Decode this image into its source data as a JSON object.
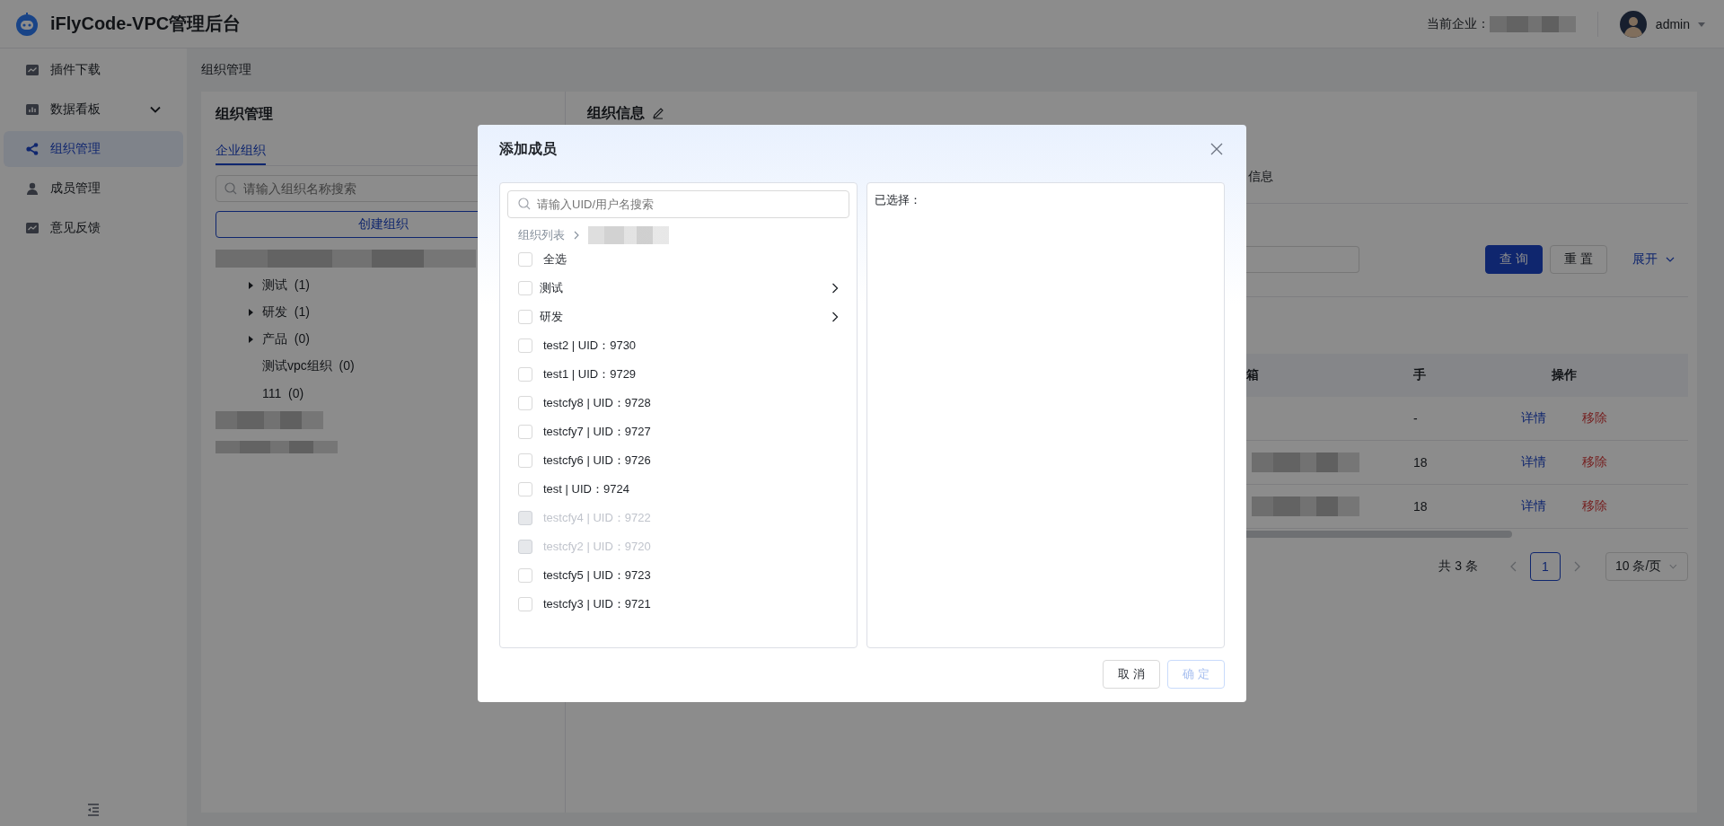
{
  "header": {
    "title": "iFlyCode-VPC管理后台",
    "company_label": "当前企业：",
    "user": "admin"
  },
  "sidebar": {
    "items": [
      {
        "label": "插件下载",
        "kind": "link",
        "selected": false
      },
      {
        "label": "数据看板",
        "kind": "submenu",
        "selected": false
      },
      {
        "label": "组织管理",
        "kind": "link",
        "selected": true
      },
      {
        "label": "成员管理",
        "kind": "link",
        "selected": false
      },
      {
        "label": "意见反馈",
        "kind": "link",
        "selected": false
      }
    ]
  },
  "breadcrumb": "组织管理",
  "org_panel": {
    "title": "组织管理",
    "tabs": [
      {
        "label": "企业组织",
        "selected": true
      }
    ],
    "search": {
      "placeholder": "请输入组织名称搜索"
    },
    "create_button": "创建组织",
    "tree": {
      "children": [
        {
          "label": "测试",
          "count": "(1)",
          "expanded": false
        },
        {
          "label": "研发",
          "count": "(1)",
          "expanded": false
        },
        {
          "label": "产品",
          "count": "(0)",
          "expanded": false
        },
        {
          "label": "测试vpc组织",
          "count": "(0)"
        },
        {
          "label": "111",
          "count": "(0)"
        }
      ]
    }
  },
  "info_panel": {
    "title": "组织信息",
    "tabs": [
      {
        "label": "信息",
        "selected": false
      }
    ],
    "buttons": [
      {
        "label": "查 询",
        "kind": "primary"
      },
      {
        "label": "重 置",
        "kind": "default"
      }
    ],
    "expand_link": "展开",
    "table": {
      "columns": [
        "箱",
        "手",
        "操作"
      ],
      "rows": [
        {
          "redacted": false,
          "column_2": "-",
          "actions": [
            {
              "label": "详情",
              "kind": "link"
            },
            {
              "label": "移除",
              "kind": "danger"
            }
          ]
        },
        {
          "redacted": true,
          "column_2": "18",
          "actions": [
            {
              "label": "详情",
              "kind": "link"
            },
            {
              "label": "移除",
              "kind": "danger"
            }
          ]
        },
        {
          "redacted": true,
          "column_2": "18",
          "actions": [
            {
              "label": "详情",
              "kind": "link"
            },
            {
              "label": "移除",
              "kind": "danger"
            }
          ]
        }
      ]
    },
    "pagination": {
      "total": "共 3 条",
      "pages": [
        {
          "label": "1",
          "selected": true
        }
      ],
      "page_size": "10 条/页"
    }
  },
  "dialog": {
    "title": "添加成员",
    "search": {
      "placeholder": "请输入UID/用户名搜索"
    },
    "breadcrumb": "组织列表",
    "select_all": {
      "label": "全选",
      "checked": false
    },
    "members": [
      {
        "label": "测试",
        "kind": "org",
        "checked": false,
        "disabled": false
      },
      {
        "label": "研发",
        "kind": "org",
        "checked": false,
        "disabled": false
      },
      {
        "label": "test2 | UID：9730",
        "kind": "user",
        "checked": false,
        "disabled": false
      },
      {
        "label": "test1 | UID：9729",
        "kind": "user",
        "checked": false,
        "disabled": false
      },
      {
        "label": "testcfy8 | UID：9728",
        "kind": "user",
        "checked": false,
        "disabled": false
      },
      {
        "label": "testcfy7 | UID：9727",
        "kind": "user",
        "checked": false,
        "disabled": false
      },
      {
        "label": "testcfy6 | UID：9726",
        "kind": "user",
        "checked": false,
        "disabled": false
      },
      {
        "label": "test | UID：9724",
        "kind": "user",
        "checked": false,
        "disabled": false
      },
      {
        "label": "testcfy4 | UID：9722",
        "kind": "user",
        "checked": false,
        "disabled": true
      },
      {
        "label": "testcfy2 | UID：9720",
        "kind": "user",
        "checked": false,
        "disabled": true
      },
      {
        "label": "testcfy5 | UID：9723",
        "kind": "user",
        "checked": false,
        "disabled": false
      },
      {
        "label": "testcfy3 | UID：9721",
        "kind": "user",
        "checked": false,
        "disabled": false
      }
    ],
    "selected_label": "已选择：",
    "buttons": [
      {
        "label": "取 消",
        "disabled": false
      },
      {
        "label": "确 定",
        "disabled": true
      }
    ]
  }
}
